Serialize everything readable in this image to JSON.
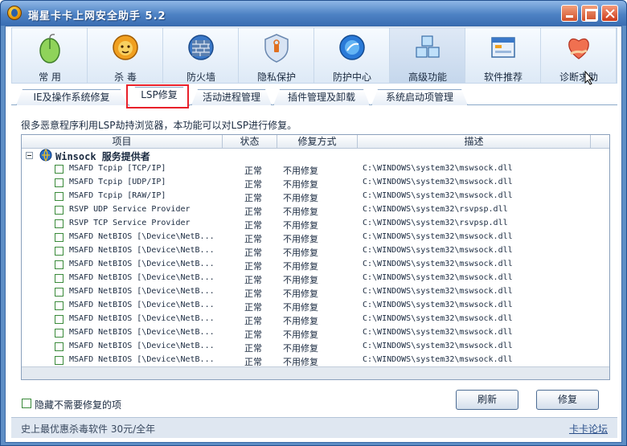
{
  "window": {
    "title": "瑞星卡卡上网安全助手 5.2"
  },
  "toolbar": {
    "items": [
      {
        "label": "常 用",
        "icon": "mouse-icon"
      },
      {
        "label": "杀 毒",
        "icon": "lion-shield-icon"
      },
      {
        "label": "防火墙",
        "icon": "firewall-icon"
      },
      {
        "label": "隐私保护",
        "icon": "privacy-shield-icon"
      },
      {
        "label": "防护中心",
        "icon": "protection-globe-icon"
      },
      {
        "label": "高级功能",
        "icon": "cubes-icon",
        "active": true
      },
      {
        "label": "软件推荐",
        "icon": "software-window-icon"
      },
      {
        "label": "诊断求助",
        "icon": "heart-hand-icon"
      }
    ]
  },
  "tabs": [
    {
      "label": "IE及操作系统修复"
    },
    {
      "label": "LSP修复",
      "selected": true
    },
    {
      "label": "活动进程管理"
    },
    {
      "label": "插件管理及卸载"
    },
    {
      "label": "系统启动项管理"
    }
  ],
  "hint": "很多恶意程序利用LSP劫持浏览器，本功能可以对LSP进行修复。",
  "grid": {
    "columns": {
      "item": "项目",
      "status": "状态",
      "mode": "修复方式",
      "desc": "描述"
    },
    "group": "Winsock 服务提供者",
    "rows": [
      {
        "name": "MSAFD Tcpip [TCP/IP]",
        "status": "正常",
        "mode": "不用修复",
        "desc": "C:\\WINDOWS\\system32\\mswsock.dll"
      },
      {
        "name": "MSAFD Tcpip [UDP/IP]",
        "status": "正常",
        "mode": "不用修复",
        "desc": "C:\\WINDOWS\\system32\\mswsock.dll"
      },
      {
        "name": "MSAFD Tcpip [RAW/IP]",
        "status": "正常",
        "mode": "不用修复",
        "desc": "C:\\WINDOWS\\system32\\mswsock.dll"
      },
      {
        "name": "RSVP UDP Service Provider",
        "status": "正常",
        "mode": "不用修复",
        "desc": "C:\\WINDOWS\\system32\\rsvpsp.dll"
      },
      {
        "name": "RSVP TCP Service Provider",
        "status": "正常",
        "mode": "不用修复",
        "desc": "C:\\WINDOWS\\system32\\rsvpsp.dll"
      },
      {
        "name": "MSAFD NetBIOS [\\Device\\NetB...",
        "status": "正常",
        "mode": "不用修复",
        "desc": "C:\\WINDOWS\\system32\\mswsock.dll"
      },
      {
        "name": "MSAFD NetBIOS [\\Device\\NetB...",
        "status": "正常",
        "mode": "不用修复",
        "desc": "C:\\WINDOWS\\system32\\mswsock.dll"
      },
      {
        "name": "MSAFD NetBIOS [\\Device\\NetB...",
        "status": "正常",
        "mode": "不用修复",
        "desc": "C:\\WINDOWS\\system32\\mswsock.dll"
      },
      {
        "name": "MSAFD NetBIOS [\\Device\\NetB...",
        "status": "正常",
        "mode": "不用修复",
        "desc": "C:\\WINDOWS\\system32\\mswsock.dll"
      },
      {
        "name": "MSAFD NetBIOS [\\Device\\NetB...",
        "status": "正常",
        "mode": "不用修复",
        "desc": "C:\\WINDOWS\\system32\\mswsock.dll"
      },
      {
        "name": "MSAFD NetBIOS [\\Device\\NetB...",
        "status": "正常",
        "mode": "不用修复",
        "desc": "C:\\WINDOWS\\system32\\mswsock.dll"
      },
      {
        "name": "MSAFD NetBIOS [\\Device\\NetB...",
        "status": "正常",
        "mode": "不用修复",
        "desc": "C:\\WINDOWS\\system32\\mswsock.dll"
      },
      {
        "name": "MSAFD NetBIOS [\\Device\\NetB...",
        "status": "正常",
        "mode": "不用修复",
        "desc": "C:\\WINDOWS\\system32\\mswsock.dll"
      },
      {
        "name": "MSAFD NetBIOS [\\Device\\NetB...",
        "status": "正常",
        "mode": "不用修复",
        "desc": "C:\\WINDOWS\\system32\\mswsock.dll"
      },
      {
        "name": "MSAFD NetBIOS [\\Device\\NetB...",
        "status": "正常",
        "mode": "不用修复",
        "desc": "C:\\WINDOWS\\system32\\mswsock.dll"
      }
    ]
  },
  "bottom": {
    "hide_label": "隐藏不需要修复的项",
    "refresh_label": "刷新",
    "repair_label": "修复"
  },
  "status": {
    "left": "史上最优惠杀毒软件 30元/全年",
    "link": "卡卡论坛"
  },
  "colors": {
    "title_bar": "#4d82c4",
    "tab_highlight": "#e8202a",
    "checkbox_border": "#3a8a3a"
  }
}
